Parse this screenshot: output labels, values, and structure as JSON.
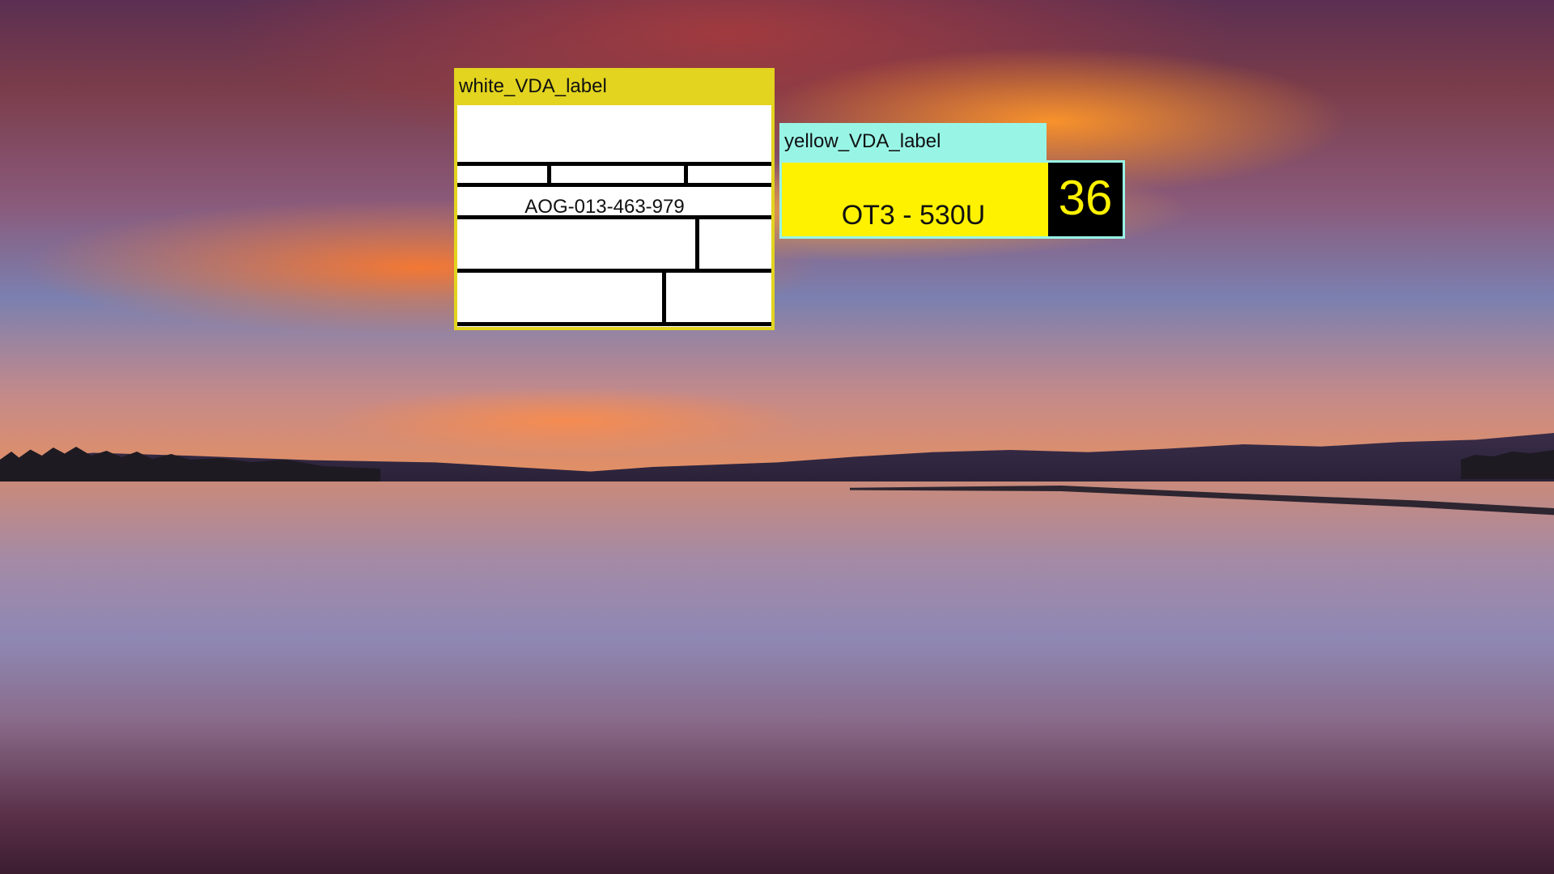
{
  "background": {
    "description_icon": "sunset-lake-wallpaper"
  },
  "white_vda": {
    "title": "white_VDA_label",
    "code": "AOG-013-463-979",
    "header_color": "#e2d41f"
  },
  "yellow_vda": {
    "title": "yellow_VDA_label",
    "code": "OT3 - 530U",
    "number": "36",
    "header_color": "#98f5e6",
    "body_color": "#fff200"
  }
}
